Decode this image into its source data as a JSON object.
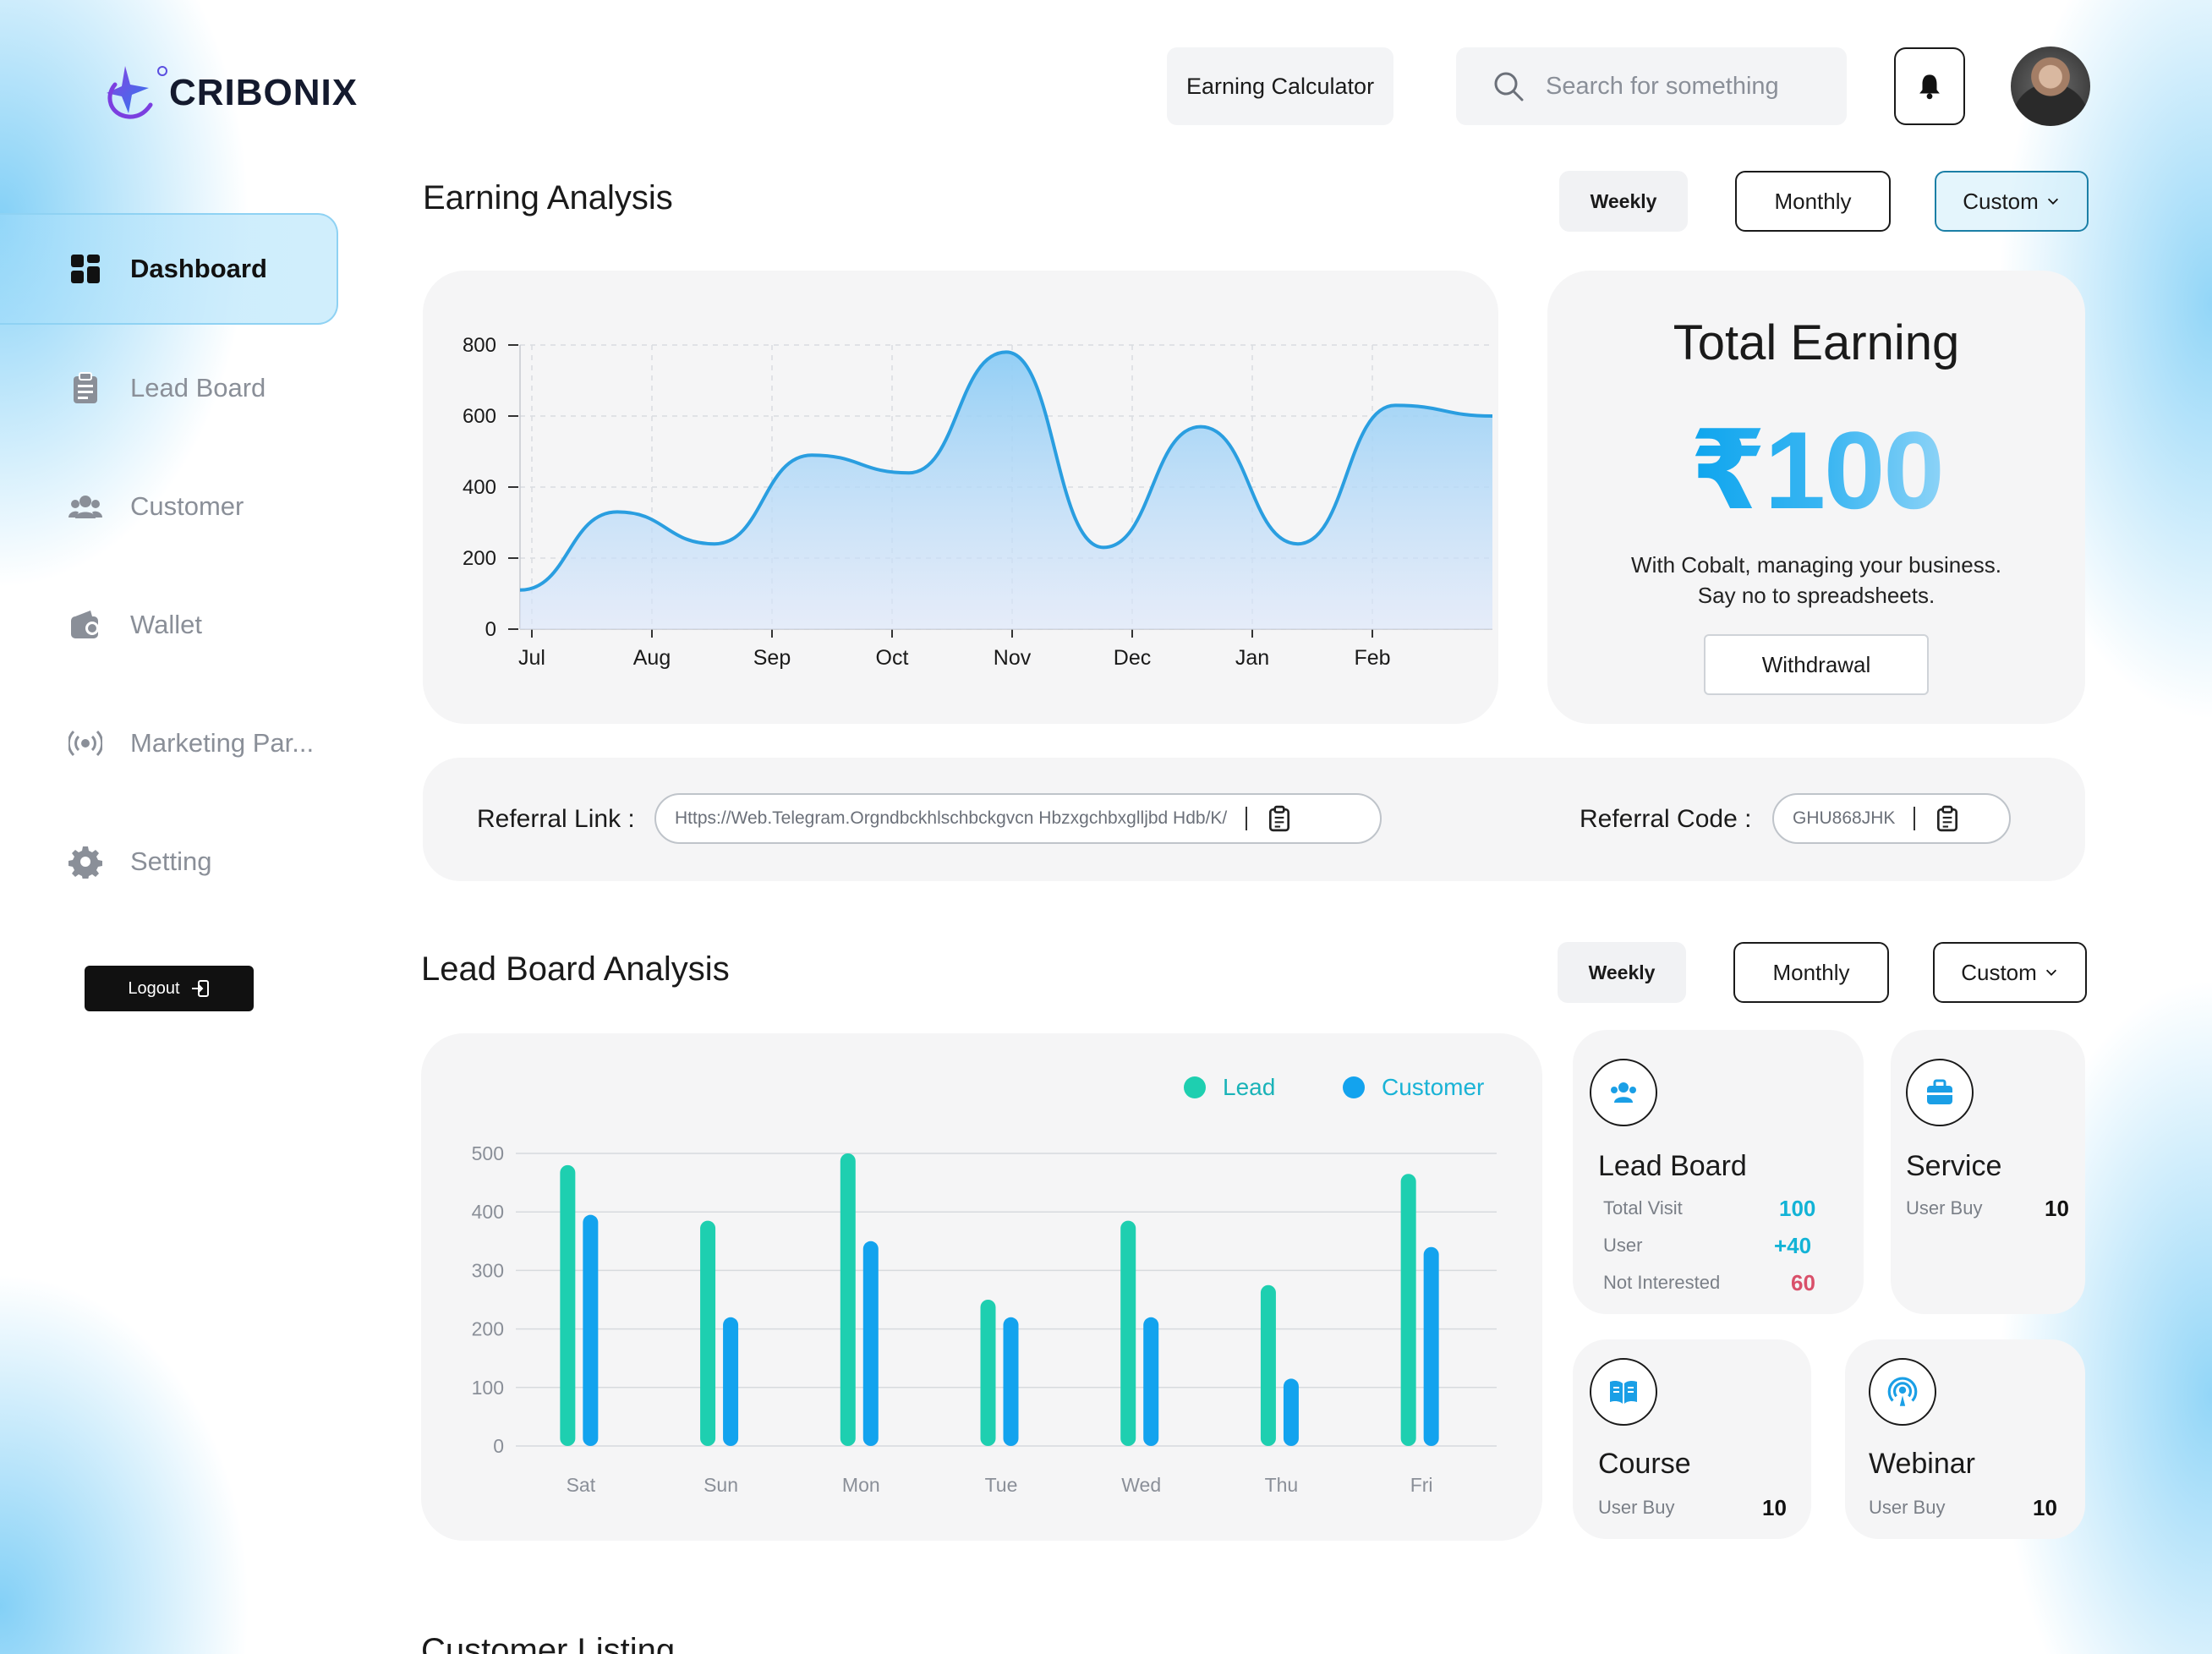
{
  "brand": {
    "name": "CRIBONIX"
  },
  "sidebar": {
    "items": [
      {
        "label": "Dashboard",
        "icon": "dashboard-icon",
        "active": true
      },
      {
        "label": "Lead Board",
        "icon": "clipboard-icon"
      },
      {
        "label": "Customer",
        "icon": "users-icon"
      },
      {
        "label": "Wallet",
        "icon": "wallet-icon"
      },
      {
        "label": "Marketing Par...",
        "icon": "broadcast-icon"
      },
      {
        "label": "Setting",
        "icon": "gear-icon"
      }
    ],
    "logout_label": "Logout"
  },
  "topbar": {
    "earning_calculator": "Earning Calculator",
    "search_placeholder": "Search for something"
  },
  "earning": {
    "title": "Earning Analysis",
    "filters": {
      "weekly": "Weekly",
      "monthly": "Monthly",
      "custom": "Custom"
    }
  },
  "total_earning": {
    "title": "Total Earning",
    "amount": "₹100",
    "desc_line1": "With Cobalt, managing your business.",
    "desc_line2": "Say no to spreadsheets.",
    "withdraw_label": "Withdrawal"
  },
  "referral": {
    "link_label": "Referral Link :",
    "link_value": "Https://Web.Telegram.Orgndbckhlschbckgvcn Hbzxgchbxglljbd Hdb/K/",
    "code_label": "Referral Code :",
    "code_value": "GHU868JHK"
  },
  "lead": {
    "title": "Lead Board Analysis",
    "filters": {
      "weekly": "Weekly",
      "monthly": "Monthly",
      "custom": "Custom"
    }
  },
  "tiles": {
    "lead_board": {
      "title": "Lead Board",
      "rows": [
        {
          "label": "Total Visit",
          "value": "100",
          "color": "#12b3d6"
        },
        {
          "label": "User",
          "value": "+40",
          "color": "#12b3d6"
        },
        {
          "label": "Not Interested",
          "value": "60",
          "color": "#d9506a"
        }
      ]
    },
    "service": {
      "title": "Service",
      "label": "User Buy",
      "value": "10"
    },
    "course": {
      "title": "Course",
      "label": "User Buy",
      "value": "10"
    },
    "webinar": {
      "title": "Webinar",
      "label": "User Buy",
      "value": "10"
    }
  },
  "customer_listing": {
    "title": "Customer Listing"
  },
  "chart_data": [
    {
      "type": "area",
      "x": [
        "Jul",
        "Aug",
        "Sep",
        "Oct",
        "Nov",
        "Dec",
        "Jan",
        "Feb"
      ],
      "points": [
        {
          "x": "Jul",
          "y": 110
        },
        {
          "x": "Jul–Aug",
          "y": 330
        },
        {
          "x": "Aug–Sep",
          "y": 240
        },
        {
          "x": "Sep",
          "y": 490
        },
        {
          "x": "Sep–Oct",
          "y": 440
        },
        {
          "x": "Oct",
          "y": 780
        },
        {
          "x": "Nov",
          "y": 230
        },
        {
          "x": "Dec",
          "y": 570
        },
        {
          "x": "Jan",
          "y": 240
        },
        {
          "x": "Feb",
          "y": 630
        },
        {
          "x": "Feb+",
          "y": 600
        }
      ],
      "ylim": [
        0,
        800
      ],
      "yticks": [
        0,
        200,
        400,
        600,
        800
      ],
      "grid": true,
      "colors": {
        "line": "#2a9ee0",
        "fill_top": "#8ecdf5",
        "fill_bottom": "#dbe6fb"
      }
    },
    {
      "type": "bar",
      "categories": [
        "Sat",
        "Sun",
        "Mon",
        "Tue",
        "Wed",
        "Thu",
        "Fri"
      ],
      "series": [
        {
          "name": "Lead",
          "color": "#1ecfb0",
          "values": [
            480,
            385,
            500,
            250,
            385,
            275,
            465
          ]
        },
        {
          "name": "Customer",
          "color": "#13a3ee",
          "values": [
            395,
            220,
            350,
            220,
            220,
            115,
            340
          ]
        }
      ],
      "ylim": [
        0,
        500
      ],
      "yticks": [
        0,
        100,
        200,
        300,
        400,
        500
      ],
      "grid": true,
      "legend": "top-right"
    }
  ]
}
